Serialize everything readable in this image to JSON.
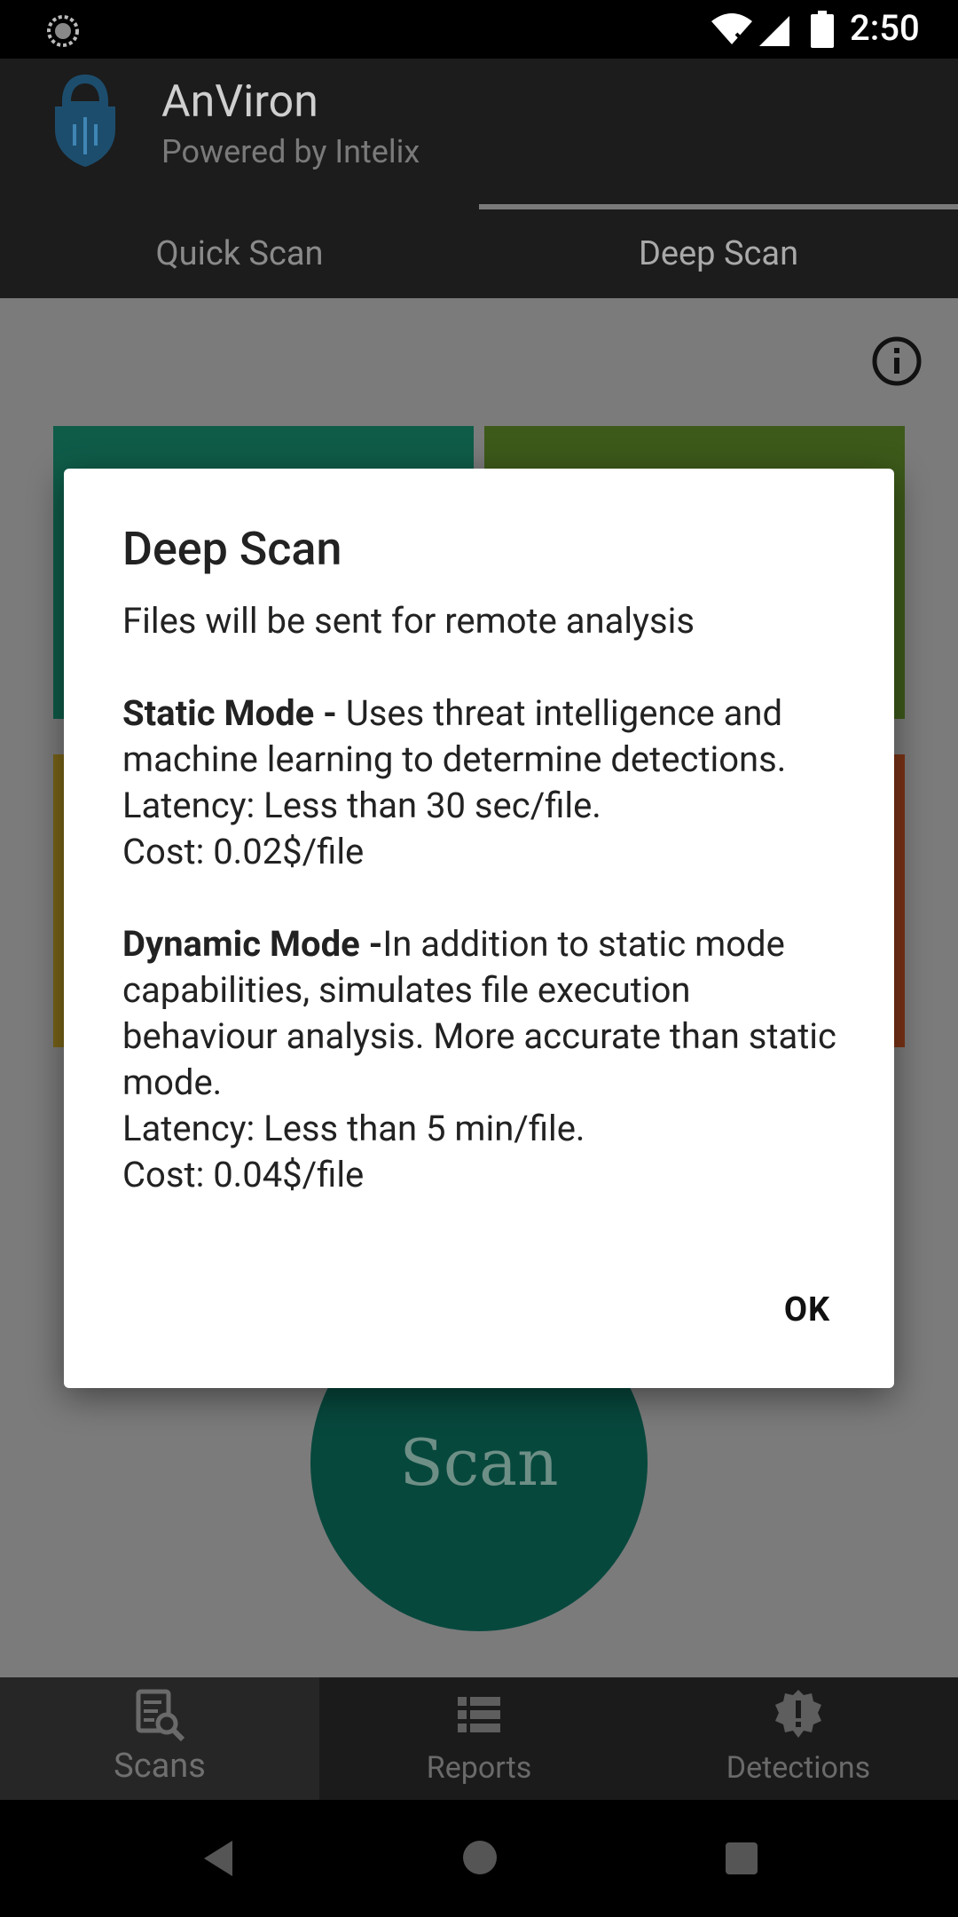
{
  "status_bar": {
    "time": "2:50",
    "icons": [
      "loading-icon",
      "wifi-icon",
      "signal-icon",
      "battery-icon"
    ]
  },
  "app": {
    "title": "AnViron",
    "subtitle": "Powered by Intelix"
  },
  "tabs": [
    {
      "label": "Quick Scan",
      "selected": false
    },
    {
      "label": "Deep Scan",
      "selected": true
    }
  ],
  "main": {
    "scan_button_label": "Scan",
    "tile_colors": [
      "#0f5c49",
      "#3d5a1a",
      "#7a6418",
      "#7b3316"
    ]
  },
  "dialog": {
    "title": "Deep Scan",
    "intro": "Files will be sent for remote analysis",
    "static_heading": "Static Mode - ",
    "static_desc": "Uses threat intelligence and machine learning to determine detections.",
    "static_latency": "Latency: Less than 30 sec/file.",
    "static_cost": "Cost: 0.02$/file",
    "dynamic_heading": "Dynamic Mode -",
    "dynamic_desc": "In addition to static mode capabilities, simulates file execution behaviour analysis. More accurate than static mode.",
    "dynamic_latency": "Latency: Less than 5 min/file.",
    "dynamic_cost": "Cost: 0.04$/file",
    "ok_label": "OK"
  },
  "bottom_nav": [
    {
      "label": "Scans",
      "icon": "scans-icon",
      "selected": true
    },
    {
      "label": "Reports",
      "icon": "reports-icon",
      "selected": false
    },
    {
      "label": "Detections",
      "icon": "detections-icon",
      "selected": false
    }
  ],
  "colors": {
    "accent": "#009e80",
    "dim_overlay": "#7b7b7b"
  }
}
